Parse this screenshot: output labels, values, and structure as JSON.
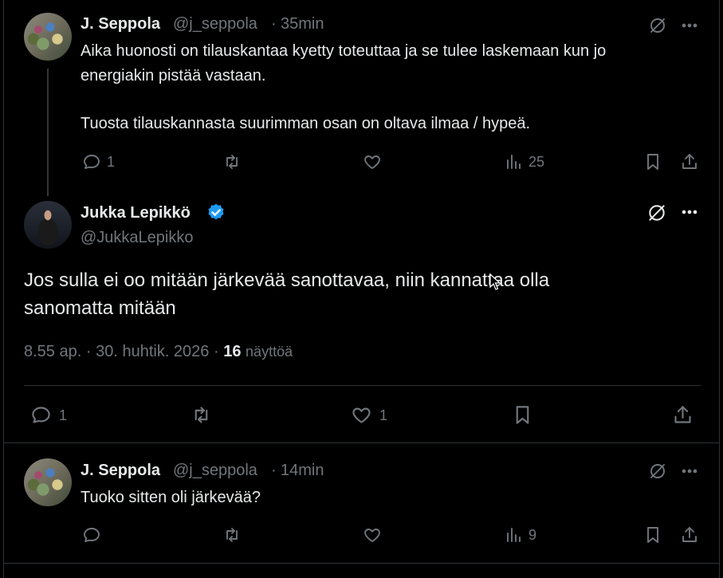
{
  "reply1": {
    "name": "J. Seppola",
    "handle": "@j_seppola",
    "separator": "·",
    "time": "35min",
    "text_line1": "Aika huonosti on tilauskantaa kyetty toteuttaa ja se tulee laskemaan kun jo",
    "text_line2": "energiakin pistää vastaan.",
    "text_line3": "Tuosta tilauskannasta suurimman osan on oltava ilmaa / hypeä.",
    "replies": "1",
    "views": "25"
  },
  "main_post": {
    "name": "Jukka Lepikkö",
    "handle": "@JukkaLepikko",
    "text_line1": "Jos sulla ei oo mitään järkevää sanottavaa, niin kannattaa olla",
    "text_line2": "sanomatta mitään",
    "time": "8.55 ap.",
    "sep1": "·",
    "date": "30. huhtik. 2026",
    "sep2": "·",
    "views_count": "16",
    "views_label": "näyttöä",
    "replies": "1",
    "likes": "1"
  },
  "reply2": {
    "name": "J. Seppola",
    "handle": "@j_seppola",
    "separator": "·",
    "time": "14min",
    "text": "Tuoko sitten oli järkevää?",
    "views": "9"
  },
  "colors": {
    "background": "#000000",
    "text": "#e7e9ea",
    "muted": "#71767b",
    "border": "#2f3336",
    "verified": "#1d9bf0"
  }
}
